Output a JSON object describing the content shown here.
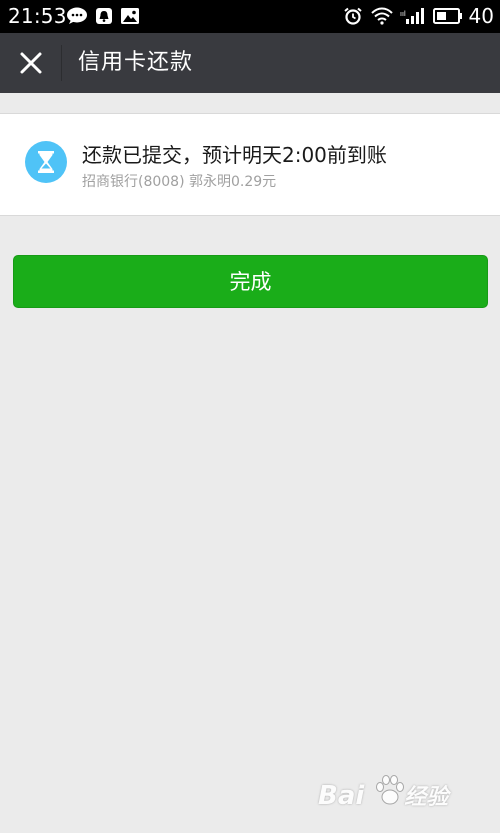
{
  "status_bar": {
    "time": "21:53",
    "battery": "40",
    "left_icons": [
      "chat-bubble-icon",
      "notification-bell-icon",
      "image-icon"
    ],
    "right_icons": [
      "alarm-clock-icon",
      "wifi-icon",
      "signal-icon",
      "battery-icon"
    ]
  },
  "header": {
    "title": "信用卡还款",
    "close_icon": "close-icon"
  },
  "result": {
    "icon": "hourglass-icon",
    "title": "还款已提交，预计明天2:00前到账",
    "detail": "招商银行(8008) 郭永明0.29元"
  },
  "actions": {
    "done_label": "完成"
  },
  "colors": {
    "status_bar": "#000000",
    "title_bar": "#393a3f",
    "background": "#ebebeb",
    "accent_green": "#1aad19",
    "hourglass_blue": "#4fc3f7"
  },
  "watermark": {
    "text": "Bai",
    "suffix": "经验"
  }
}
